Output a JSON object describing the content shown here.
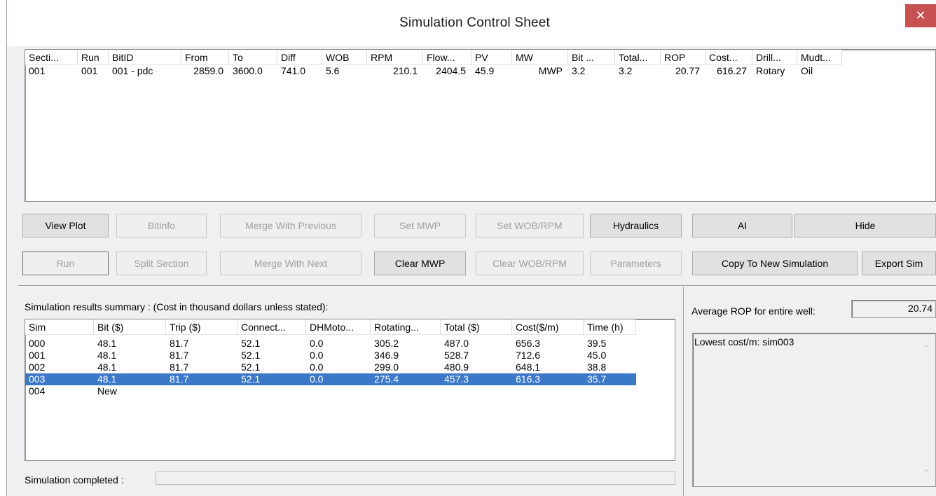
{
  "window": {
    "title": "Simulation Control Sheet",
    "close_glyph": "✕"
  },
  "sections_table": {
    "columns": [
      "Secti...",
      "Run",
      "BitID",
      "From",
      "To",
      "Diff",
      "WOB",
      "RPM",
      "Flow...",
      "PV",
      "MW",
      "Bit ...",
      "Total...",
      "ROP",
      "Cost...",
      "Drill...",
      "Mudt..."
    ],
    "rows": [
      [
        "001",
        "001",
        "001 - pdc",
        "2859.0",
        "3600.0",
        "741.0",
        "5.6",
        "210.1",
        "2404.5",
        "45.9",
        "MWP",
        "3.2",
        "3.2",
        "20.77",
        "616.27",
        "Rotary",
        "Oil"
      ]
    ]
  },
  "buttons": {
    "view_plot": "View Plot",
    "bitinfo": "Bitinfo",
    "merge_previous": "Merge With Previous",
    "set_mwp": "Set MWP",
    "set_wob_rpm": "Set WOB/RPM",
    "hydraulics": "Hydraulics",
    "ai": "AI",
    "hide": "Hide",
    "run": "Run",
    "split_section": "Split Section",
    "merge_next": "Merge With Next",
    "clear_mwp": "Clear MWP",
    "clear_wob_rpm": "Clear WOB/RPM",
    "parameters": "Parameters",
    "copy_new_sim": "Copy To New Simulation",
    "export_sim": "Export Sim"
  },
  "summary": {
    "caption": "Simulation results summary : (Cost  in thousand dollars unless stated):",
    "columns": [
      "Sim",
      "Bit ($)",
      "Trip ($)",
      "Connect...",
      "DHMoto...",
      "Rotating...",
      "Total ($)",
      "Cost($/m)",
      "Time (h)"
    ],
    "rows": [
      [
        "000",
        "48.1",
        "81.7",
        "52.1",
        "0.0",
        "305.2",
        "487.0",
        "656.3",
        "39.5"
      ],
      [
        "001",
        "48.1",
        "81.7",
        "52.1",
        "0.0",
        "346.9",
        "528.7",
        "712.6",
        "45.0"
      ],
      [
        "002",
        "48.1",
        "81.7",
        "52.1",
        "0.0",
        "299.0",
        "480.9",
        "648.1",
        "38.8"
      ],
      [
        "003",
        "48.1",
        "81.7",
        "52.1",
        "0.0",
        "275.4",
        "457.3",
        "616.3",
        "35.7"
      ],
      [
        "004",
        "New",
        "",
        "",
        "",
        "",
        "",
        "",
        ""
      ]
    ],
    "selected_row": "003",
    "status_label": "Simulation completed :"
  },
  "right_panel": {
    "avg_rop_label": "Average ROP for entire well:",
    "avg_rop_value": "20.74",
    "memo_text": "Lowest cost/m: sim003",
    "scroll_up_glyph": "⌃",
    "scroll_down_glyph": "⌄"
  },
  "colors": {
    "selection": "#3c78c8",
    "close_button": "#c75050",
    "window_bg": "#f0f0f0"
  }
}
